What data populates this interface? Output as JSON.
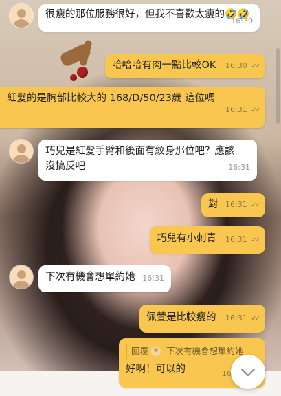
{
  "messages": [
    {
      "text": "很瘦的那位服務很好，但我不喜歡太瘦的🤣🤣",
      "time": "16:30",
      "side": "left"
    },
    {
      "text": "哈哈哈有肉一點比較OK",
      "time": "16:30",
      "side": "right"
    },
    {
      "text": "紅髮的是胸部比較大的 168/D/50/23歲 這位嗎",
      "time": "16:31",
      "side": "left"
    },
    {
      "text": "巧兒是紅髮手臂和後面有紋身那位吧？應該沒搞反吧",
      "time": "16:31",
      "side": "left"
    },
    {
      "text": "對",
      "time": "16:31",
      "side": "right"
    },
    {
      "text": "巧兒有小刺青",
      "time": "16:31",
      "side": "right"
    },
    {
      "text": "下次有機會想單約她",
      "time": "16:31",
      "side": "left"
    },
    {
      "text": "佩萱是比較瘦的",
      "time": "16:31",
      "side": "right"
    },
    {
      "text": "好啊！可以的",
      "time": "16:3",
      "side": "right",
      "reply": {
        "label": "回覆",
        "quote": "下次有機會想單約她"
      }
    }
  ],
  "read_mark": "✓✓",
  "scroll_down_icon": "chevron-down-icon",
  "colors": {
    "bubble_out": "#f9c74f",
    "bubble_in": "#ffffff"
  }
}
